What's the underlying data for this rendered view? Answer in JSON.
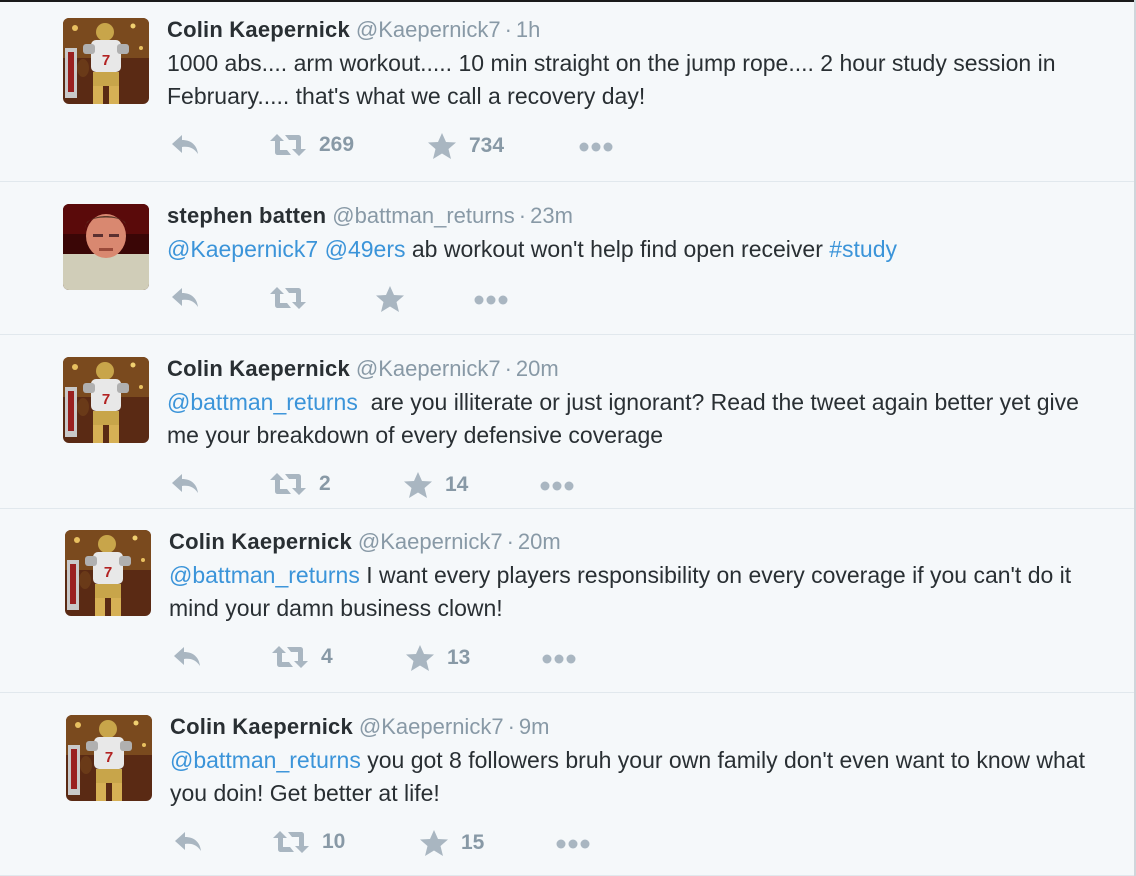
{
  "tweets": [
    {
      "name": "Colin Kaepernick",
      "handle": "@Kaepernick7",
      "time": "1h",
      "avatar": "player-avatar",
      "text": [
        {
          "t": "1000 abs.... arm workout..... 10 min straight on the jump rope.... 2 hour study session in February..... that's what we call a recovery day!",
          "link": false
        }
      ],
      "retweets": "269",
      "favorites": "734"
    },
    {
      "name": "stephen batten",
      "handle": "@battman_returns",
      "time": "23m",
      "avatar": "person-avatar",
      "text": [
        {
          "t": "@Kaepernick7",
          "link": true
        },
        {
          "t": " ",
          "link": false
        },
        {
          "t": "@49ers",
          "link": true
        },
        {
          "t": " ab workout won't help find open receiver ",
          "link": false
        },
        {
          "t": "#study",
          "link": true
        }
      ],
      "retweets": "",
      "favorites": ""
    },
    {
      "name": "Colin Kaepernick",
      "handle": "@Kaepernick7",
      "time": "20m",
      "avatar": "player-avatar",
      "text": [
        {
          "t": "@battman_returns",
          "link": true
        },
        {
          "t": "  are you illiterate or just ignorant? Read the tweet again better yet give me your breakdown of every defensive coverage",
          "link": false
        }
      ],
      "retweets": "2",
      "favorites": "14"
    },
    {
      "name": "Colin Kaepernick",
      "handle": "@Kaepernick7",
      "time": "20m",
      "avatar": "player-avatar",
      "text": [
        {
          "t": "@battman_returns",
          "link": true
        },
        {
          "t": " I want every players responsibility on every coverage if you can't do it mind your damn business clown!",
          "link": false
        }
      ],
      "retweets": "4",
      "favorites": "13"
    },
    {
      "name": "Colin Kaepernick",
      "handle": "@Kaepernick7",
      "time": "9m",
      "avatar": "player-avatar",
      "text": [
        {
          "t": "@battman_returns",
          "link": true
        },
        {
          "t": " you got 8 followers bruh your own family don't even want to know what you doin! Get better at life!",
          "link": false
        }
      ],
      "retweets": "10",
      "favorites": "15"
    }
  ],
  "separator": "·",
  "colors": {
    "link": "#3b94d9",
    "muted": "#8899a6",
    "background": "#f5f8fa"
  },
  "icons": {
    "reply": "reply-icon",
    "retweet": "retweet-icon",
    "favorite": "star-icon",
    "more": "more-icon"
  }
}
